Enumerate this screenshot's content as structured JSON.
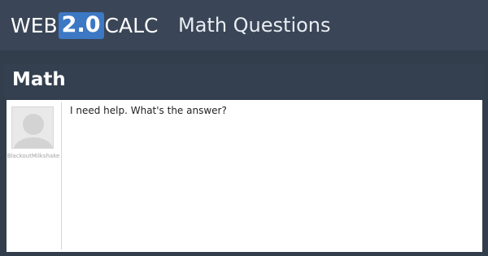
{
  "header": {
    "logo": {
      "prefix": "WEB",
      "badge": "2.0",
      "suffix": "CALC"
    },
    "section_title": "Math Questions"
  },
  "category": {
    "title": "Math"
  },
  "question": {
    "username": "BlackoutMilkshake",
    "text": "I need help. What's the answer?",
    "avatar_icon": "default-user-avatar-icon"
  },
  "colors": {
    "header_bg": "#3a4657",
    "page_bg": "#323e4c",
    "logo_badge": "#3c78c4"
  }
}
